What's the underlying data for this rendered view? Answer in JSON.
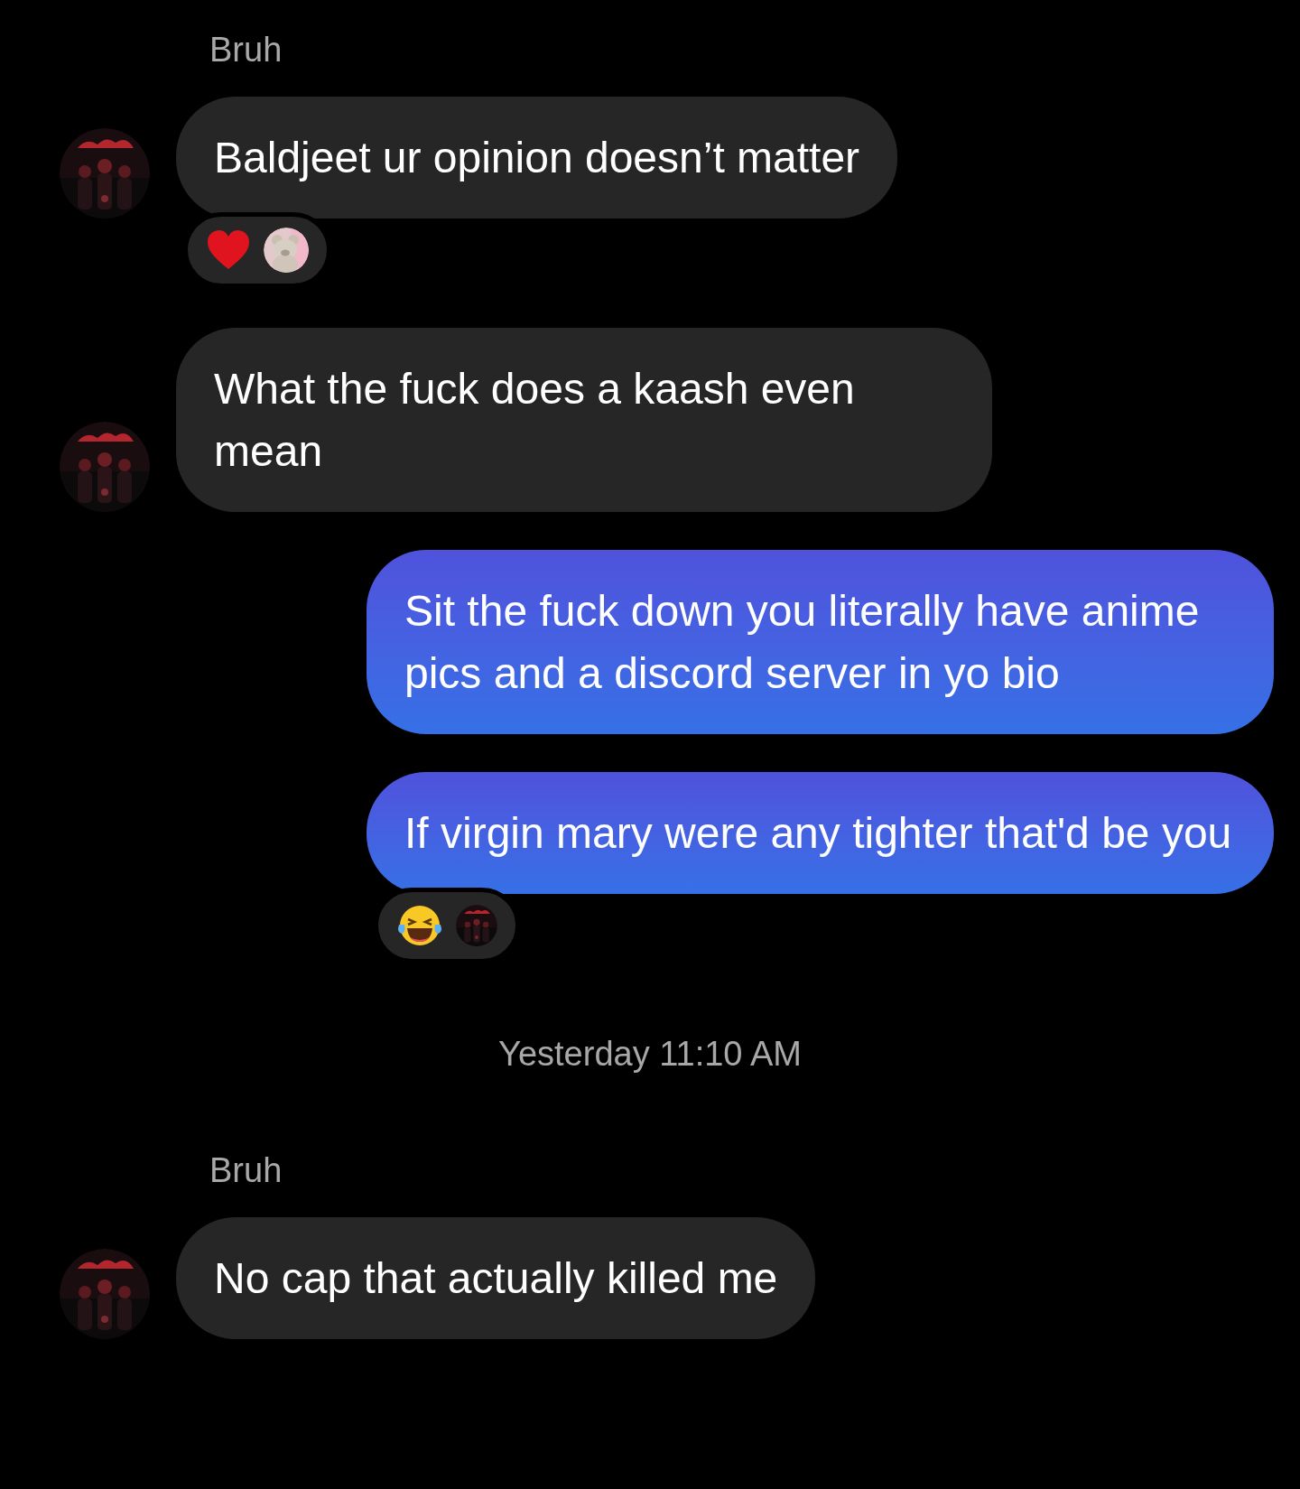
{
  "messages": [
    {
      "kind": "sender_name",
      "text": "Bruh"
    },
    {
      "kind": "incoming",
      "text": "Baldjeet ur opinion doesn’t matter",
      "reactions": [
        {
          "kind": "heart"
        },
        {
          "kind": "picture"
        }
      ]
    },
    {
      "kind": "incoming",
      "text": "What the fuck does a kaash even mean"
    },
    {
      "kind": "outgoing",
      "text": "Sit the fuck down you literally have anime pics and a discord server in yo bio"
    },
    {
      "kind": "outgoing",
      "text": "If virgin mary were any tighter that'd be you",
      "reactions": [
        {
          "kind": "laugh"
        },
        {
          "kind": "picture"
        }
      ]
    },
    {
      "kind": "timestamp",
      "text": "Yesterday 11:10 AM"
    },
    {
      "kind": "sender_name",
      "text": "Bruh"
    },
    {
      "kind": "incoming",
      "text": "No cap that actually killed me"
    }
  ]
}
